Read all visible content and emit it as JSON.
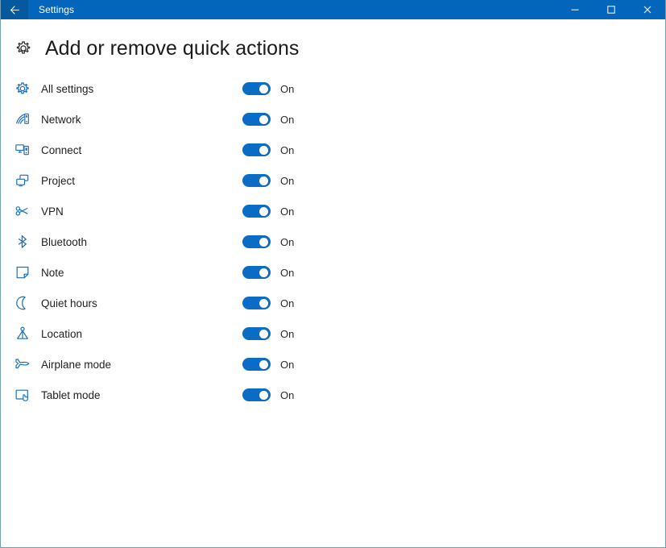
{
  "window": {
    "title": "Settings",
    "back_icon": "back-arrow-icon",
    "controls": [
      {
        "name": "minimize-button",
        "icon": "minimize-icon",
        "label": "—"
      },
      {
        "name": "maximize-button",
        "icon": "maximize-icon",
        "label": "□"
      },
      {
        "name": "close-button",
        "icon": "close-icon",
        "label": "✕"
      }
    ]
  },
  "page": {
    "title": "Add or remove quick actions",
    "title_icon": "gear-icon"
  },
  "quick_actions": [
    {
      "label": "All settings",
      "icon": "gear-icon",
      "state": "On",
      "enabled": true
    },
    {
      "label": "Network",
      "icon": "wifi-icon",
      "state": "On",
      "enabled": true
    },
    {
      "label": "Connect",
      "icon": "connect-icon",
      "state": "On",
      "enabled": true
    },
    {
      "label": "Project",
      "icon": "project-icon",
      "state": "On",
      "enabled": true
    },
    {
      "label": "VPN",
      "icon": "vpn-key-icon",
      "state": "On",
      "enabled": true
    },
    {
      "label": "Bluetooth",
      "icon": "bluetooth-icon",
      "state": "On",
      "enabled": true
    },
    {
      "label": "Note",
      "icon": "note-icon",
      "state": "On",
      "enabled": true
    },
    {
      "label": "Quiet hours",
      "icon": "moon-icon",
      "state": "On",
      "enabled": true
    },
    {
      "label": "Location",
      "icon": "location-pin-icon",
      "state": "On",
      "enabled": true
    },
    {
      "label": "Airplane mode",
      "icon": "airplane-icon",
      "state": "On",
      "enabled": true
    },
    {
      "label": "Tablet mode",
      "icon": "tablet-mode-icon",
      "state": "On",
      "enabled": true
    }
  ],
  "colors": {
    "titlebar": "#0366ba",
    "back_button": "#04599f",
    "accent_toggle": "#0a6cc4",
    "icon_blue": "#1c6fb8",
    "window_border": "#6f9fb5",
    "text": "#1f1f1f"
  }
}
